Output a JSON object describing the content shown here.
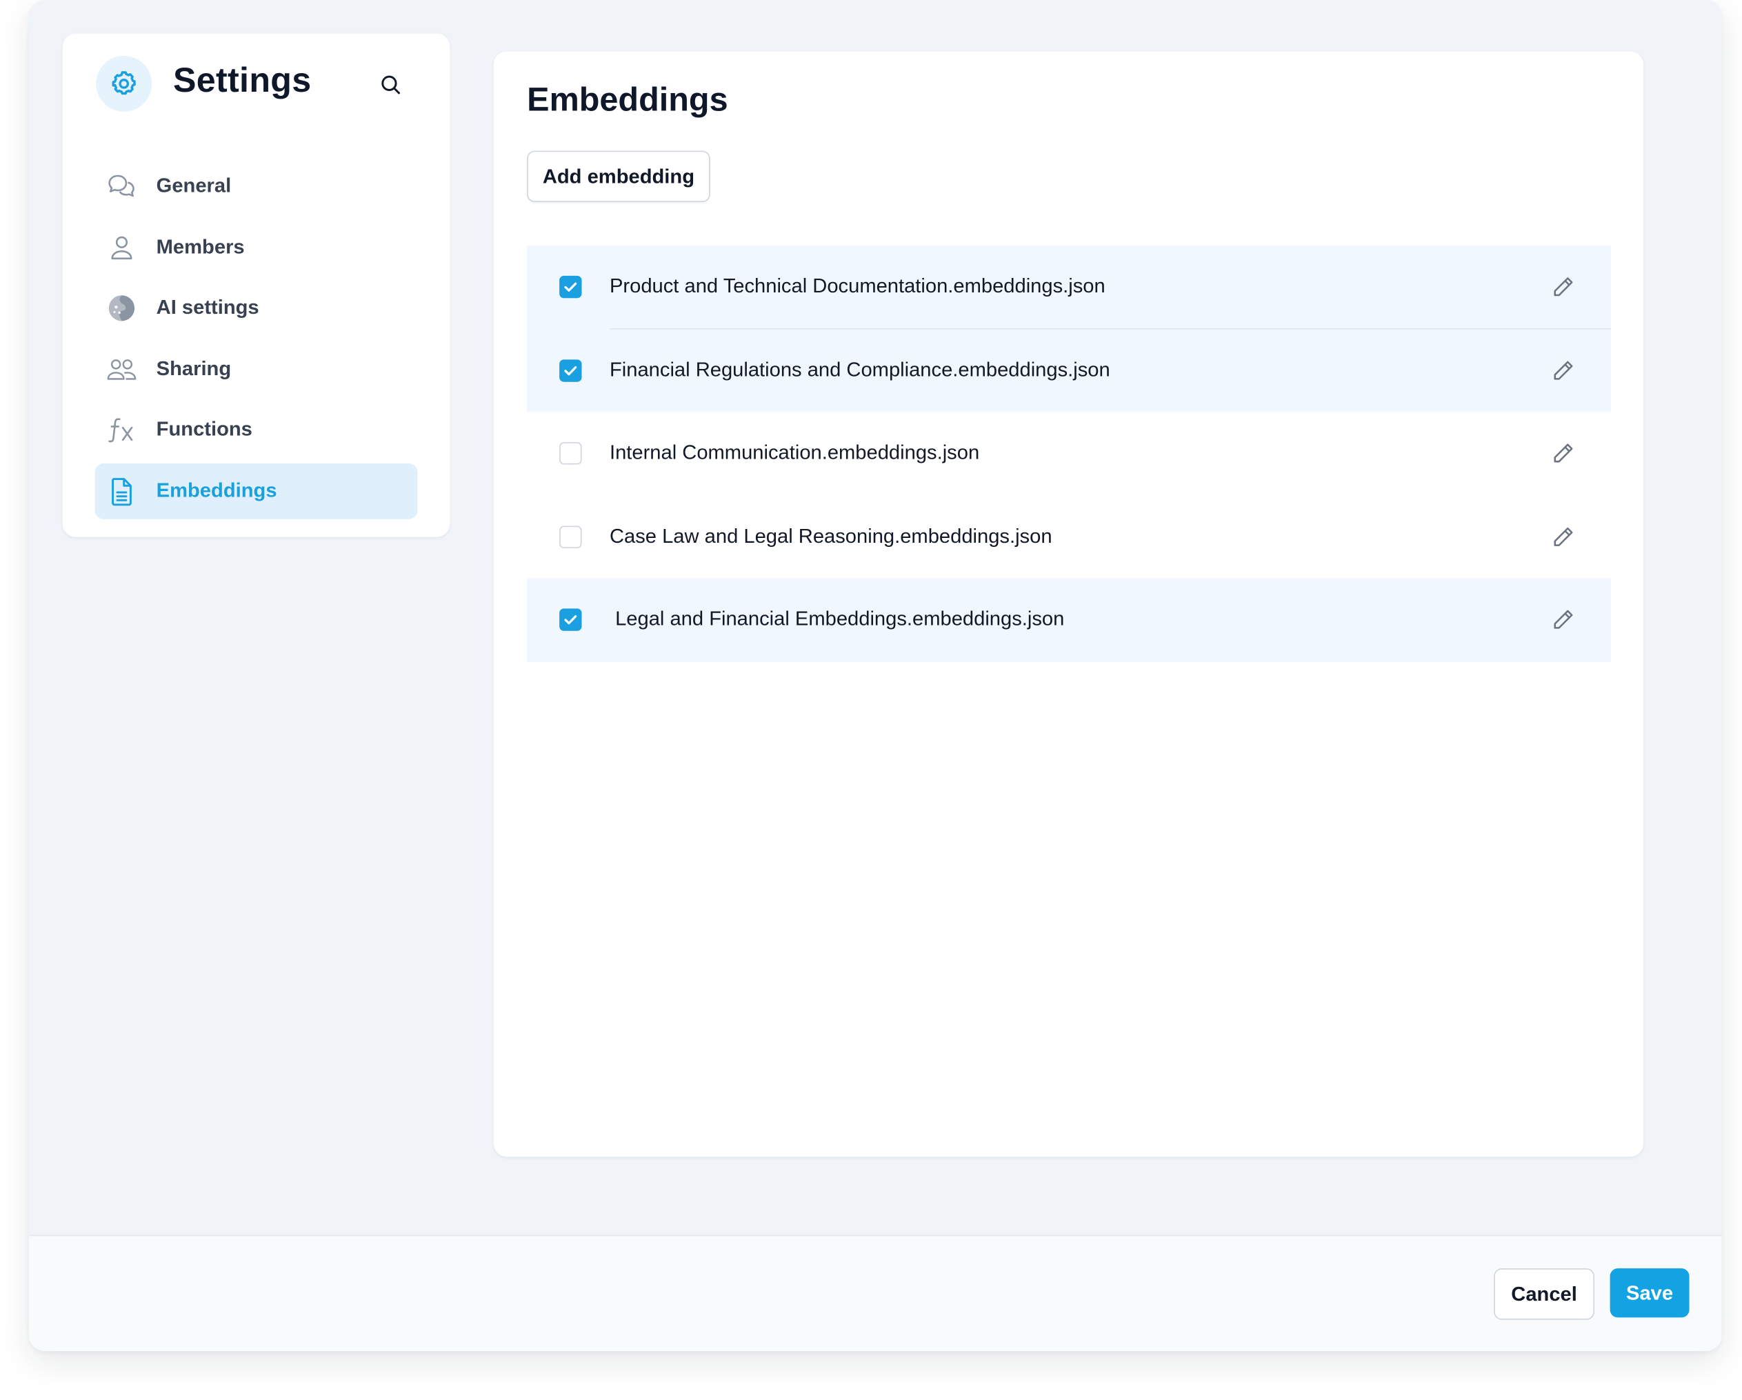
{
  "sidebar": {
    "title": "Settings",
    "items": [
      {
        "label": "General",
        "icon": "chat-bubbles-icon"
      },
      {
        "label": "Members",
        "icon": "user-icon"
      },
      {
        "label": "AI settings",
        "icon": "ai-brain-icon"
      },
      {
        "label": "Sharing",
        "icon": "users-icon"
      },
      {
        "label": "Functions",
        "icon": "function-fx-icon"
      },
      {
        "label": "Embeddings",
        "icon": "document-icon",
        "active": true
      }
    ]
  },
  "main": {
    "title": "Embeddings",
    "add_button_label": "Add embedding",
    "embeddings": [
      {
        "name": "Product and Technical Documentation.embeddings.json",
        "checked": true
      },
      {
        "name": "Financial Regulations and Compliance.embeddings.json",
        "checked": true
      },
      {
        "name": "Internal Communication.embeddings.json",
        "checked": false
      },
      {
        "name": "Case Law and Legal Reasoning.embeddings.json",
        "checked": false
      },
      {
        "name": "Legal and Financial Embeddings.embeddings.json",
        "checked": true
      }
    ]
  },
  "footer": {
    "cancel_label": "Cancel",
    "save_label": "Save"
  },
  "colors": {
    "accent": "#14a3e2",
    "active_nav_bg": "#dff0fc",
    "checked_row_bg": "#f0f7fe",
    "window_bg": "#f0f4f9"
  }
}
